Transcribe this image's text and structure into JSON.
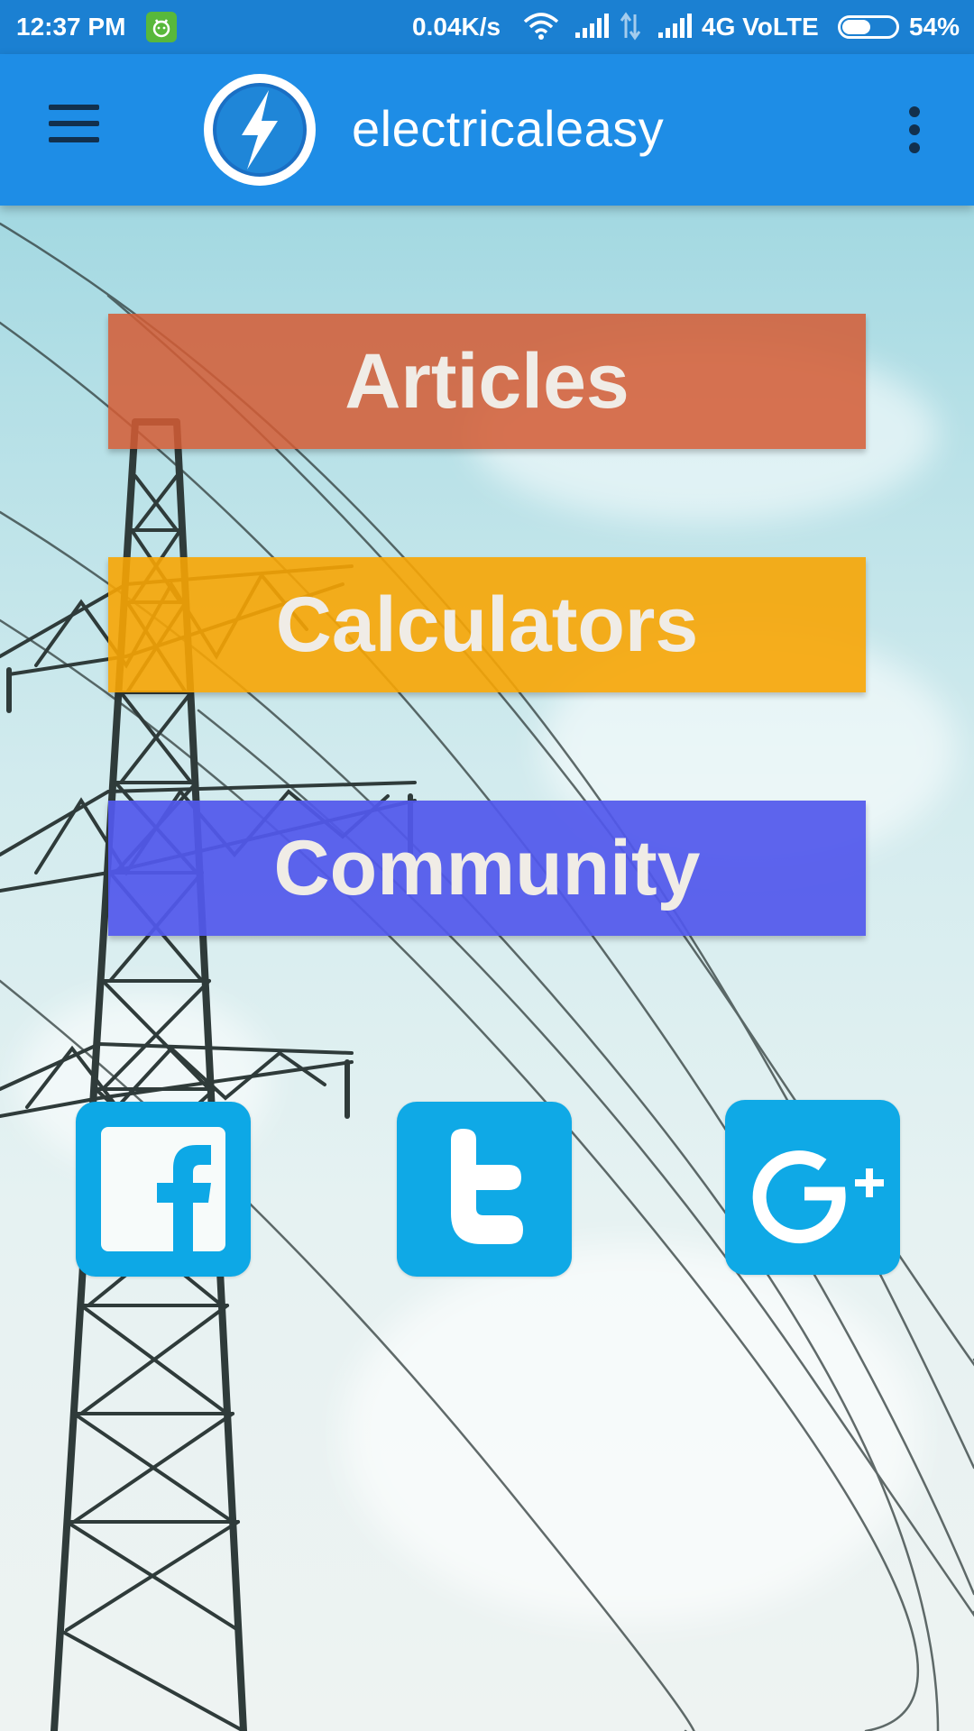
{
  "status_bar": {
    "time": "12:37 PM",
    "speed": "0.04K/s",
    "network": "4G  VoLTE",
    "battery_label": "54%",
    "battery_level": 0.54
  },
  "app_bar": {
    "title": "electricaleasy",
    "menu_icon": "hamburger-menu-icon",
    "logo_icon": "lightning-bolt-logo",
    "overflow_icon": "more-vert-icon"
  },
  "menu": {
    "articles_label": "Articles",
    "calculators_label": "Calculators",
    "community_label": "Community"
  },
  "social": [
    {
      "name": "facebook",
      "icon": "facebook-icon"
    },
    {
      "name": "twitter",
      "icon": "twitter-icon"
    },
    {
      "name": "google-plus",
      "icon": "google-plus-icon"
    }
  ],
  "colors": {
    "status_bar": "#1b80d2",
    "app_bar": "#1e8de6",
    "articles": "#d45c34",
    "calculators": "#f7a504",
    "community": "#5258ec",
    "social": "#0fa9e6"
  }
}
